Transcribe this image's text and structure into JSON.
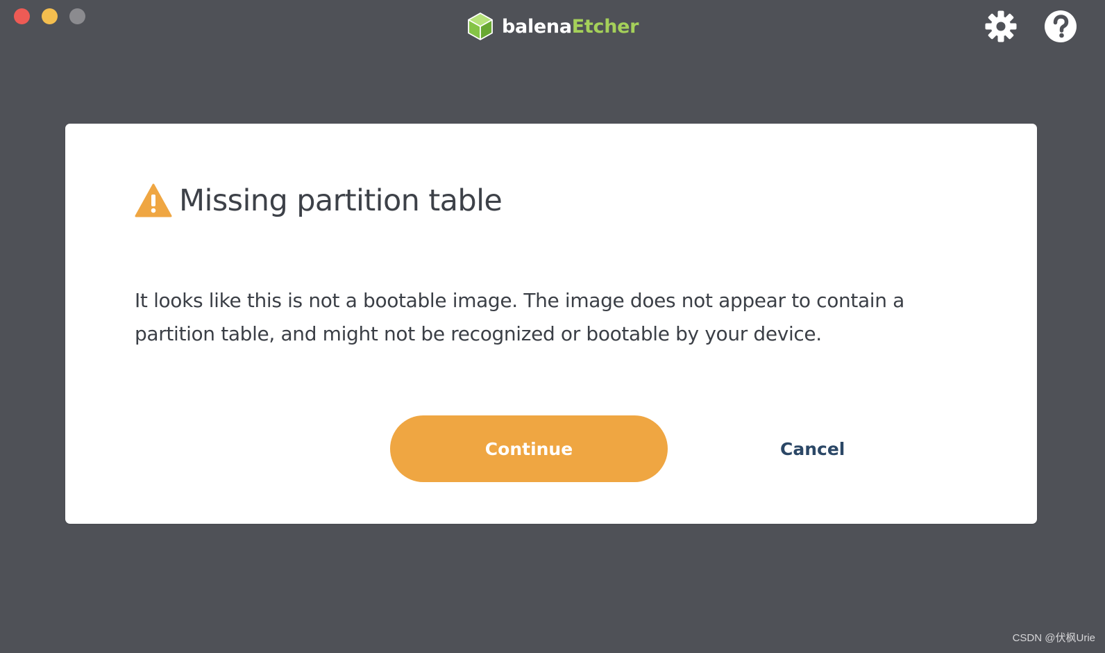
{
  "window": {
    "traffic_lights": [
      "close",
      "minimize",
      "maximize"
    ]
  },
  "brand": {
    "name_part1": "balena",
    "name_part2": "Etcher",
    "logo_icon": "cube-logo-icon",
    "colors": {
      "part1": "#ffffff",
      "part2": "#a5d05a"
    }
  },
  "toolbar": {
    "settings_icon": "gear-icon",
    "help_icon": "question-circle-icon"
  },
  "dialog": {
    "icon": "warning-triangle-icon",
    "title": "Missing partition table",
    "body": "It looks like this is not a bootable image. The image does not appear to contain a partition table, and might not be recognized or bootable by your device.",
    "continue_label": "Continue",
    "cancel_label": "Cancel"
  },
  "colors": {
    "background": "#4f5157",
    "accent": "#efa642",
    "cancel_text": "#2b4766"
  },
  "watermark": "CSDN @伏枫Urie"
}
